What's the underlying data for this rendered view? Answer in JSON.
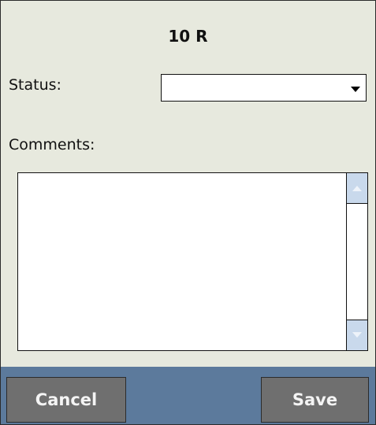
{
  "form": {
    "title": "10 R",
    "status_label": "Status:",
    "status_value": "",
    "comments_label": "Comments:",
    "comments_value": ""
  },
  "buttons": {
    "cancel_label": "Cancel",
    "save_label": "Save"
  },
  "colors": {
    "background": "#e7e9de",
    "footer": "#5c7a9c",
    "button": "#6f6f6f",
    "scroll_button": "#c9d9ec"
  },
  "icons": {
    "dropdown": "chevron-down-icon",
    "scroll_up": "scroll-up-arrow-icon",
    "scroll_down": "scroll-down-arrow-icon"
  }
}
